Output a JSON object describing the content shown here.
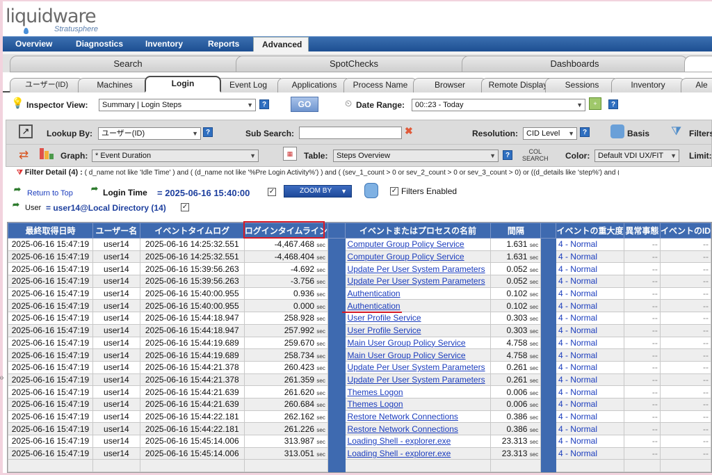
{
  "logo": {
    "name": "liquidware",
    "product": "Stratusphere"
  },
  "topnav": {
    "items": [
      "Overview",
      "Diagnostics",
      "Inventory",
      "Reports",
      "Advanced"
    ],
    "active": "Advanced"
  },
  "section_tabs": [
    "Search",
    "SpotChecks",
    "Dashboards"
  ],
  "sub_tabs": [
    "ユーザー(ID)",
    "Machines",
    "Login",
    "Event Log",
    "Applications",
    "Process Name",
    "Browser",
    "Remote Display",
    "Sessions",
    "Inventory",
    "Ale"
  ],
  "inspector": {
    "label": "Inspector View:",
    "value": "Summary | Login Steps",
    "go": "GO",
    "date_label": "Date Range:",
    "date_value": "00::23 - Today"
  },
  "toolbar": {
    "lookup_label": "Lookup By:",
    "lookup_value": "ユーザー(ID)",
    "subsearch_label": "Sub Search:",
    "resolution_label": "Resolution:",
    "resolution_value": "CID Level",
    "basis": "Basis",
    "filters": "Filters",
    "graph_label": "Graph:",
    "graph_value": "* Event Duration",
    "table_label": "Table:",
    "table_value": "Steps Overview",
    "col_search": "COL",
    "col_search2": "SEARCH",
    "color_label": "Color:",
    "color_value": "Default VDI UX/FIT",
    "limit_label": "Limit:"
  },
  "filter": {
    "label": "Filter Detail (4) :",
    "text": "( d_name not like 'Idle Time' )  and  ( (d_name not like '%Pre Login Activity%') )  and  ( (sev_1_count > 0 or sev_2_count > 0 or sev_3_count > 0) or ((d_details like 'step%') and (d_name not like"
  },
  "nav": {
    "return": "Return to Top",
    "login_time_label": "Login Time",
    "login_time_value": "= 2025-06-16 15:40:00",
    "zoom": "ZOOM BY",
    "filters_enabled": "Filters Enabled",
    "user_label": "User",
    "user_value": "= user14@Local Directory (14)"
  },
  "table": {
    "headers": [
      "最終取得日時",
      "ユーザー名",
      "イベントタイムログ",
      "ログインタイムライン",
      "",
      "イベントまたはプロセスの名前",
      "間隔",
      "",
      "イベントの重大度",
      "異常事態",
      "イベントのID"
    ],
    "unit": "sec",
    "rows": [
      [
        "2025-06-16 15:47:19",
        "user14",
        "2025-06-16 14:25:32.551",
        "-4,467.468",
        "Computer Group Policy Service",
        "1.631",
        "4 - Normal",
        "--",
        "--"
      ],
      [
        "2025-06-16 15:47:19",
        "user14",
        "2025-06-16 14:25:32.551",
        "-4,468.404",
        "Computer Group Policy Service",
        "1.631",
        "4 - Normal",
        "--",
        "--"
      ],
      [
        "2025-06-16 15:47:19",
        "user14",
        "2025-06-16 15:39:56.263",
        "-4.692",
        "Update Per User System Parameters",
        "0.052",
        "4 - Normal",
        "--",
        "--"
      ],
      [
        "2025-06-16 15:47:19",
        "user14",
        "2025-06-16 15:39:56.263",
        "-3.756",
        "Update Per User System Parameters",
        "0.052",
        "4 - Normal",
        "--",
        "--"
      ],
      [
        "2025-06-16 15:47:19",
        "user14",
        "2025-06-16 15:40:00.955",
        "0.936",
        "Authentication",
        "0.102",
        "4 - Normal",
        "--",
        "--"
      ],
      [
        "2025-06-16 15:47:19",
        "user14",
        "2025-06-16 15:40:00.955",
        "0.000",
        "Authentication",
        "0.102",
        "4 - Normal",
        "--",
        "--"
      ],
      [
        "2025-06-16 15:47:19",
        "user14",
        "2025-06-16 15:44:18.947",
        "258.928",
        "User Profile Service",
        "0.303",
        "4 - Normal",
        "--",
        "--"
      ],
      [
        "2025-06-16 15:47:19",
        "user14",
        "2025-06-16 15:44:18.947",
        "257.992",
        "User Profile Service",
        "0.303",
        "4 - Normal",
        "--",
        "--"
      ],
      [
        "2025-06-16 15:47:19",
        "user14",
        "2025-06-16 15:44:19.689",
        "259.670",
        "Main User Group Policy Service",
        "4.758",
        "4 - Normal",
        "--",
        "--"
      ],
      [
        "2025-06-16 15:47:19",
        "user14",
        "2025-06-16 15:44:19.689",
        "258.734",
        "Main User Group Policy Service",
        "4.758",
        "4 - Normal",
        "--",
        "--"
      ],
      [
        "2025-06-16 15:47:19",
        "user14",
        "2025-06-16 15:44:21.378",
        "260.423",
        "Update Per User System Parameters",
        "0.261",
        "4 - Normal",
        "--",
        "--"
      ],
      [
        "2025-06-16 15:47:19",
        "user14",
        "2025-06-16 15:44:21.378",
        "261.359",
        "Update Per User System Parameters",
        "0.261",
        "4 - Normal",
        "--",
        "--"
      ],
      [
        "2025-06-16 15:47:19",
        "user14",
        "2025-06-16 15:44:21.639",
        "261.620",
        "Themes Logon",
        "0.006",
        "4 - Normal",
        "--",
        "--"
      ],
      [
        "2025-06-16 15:47:19",
        "user14",
        "2025-06-16 15:44:21.639",
        "260.684",
        "Themes Logon",
        "0.006",
        "4 - Normal",
        "--",
        "--"
      ],
      [
        "2025-06-16 15:47:19",
        "user14",
        "2025-06-16 15:44:22.181",
        "262.162",
        "Restore Network Connections",
        "0.386",
        "4 - Normal",
        "--",
        "--"
      ],
      [
        "2025-06-16 15:47:19",
        "user14",
        "2025-06-16 15:44:22.181",
        "261.226",
        "Restore Network Connections",
        "0.386",
        "4 - Normal",
        "--",
        "--"
      ],
      [
        "2025-06-16 15:47:19",
        "user14",
        "2025-06-16 15:45:14.006",
        "313.987",
        "Loading Shell - explorer.exe",
        "23.313",
        "4 - Normal",
        "--",
        "--"
      ],
      [
        "2025-06-16 15:47:19",
        "user14",
        "2025-06-16 15:45:14.006",
        "313.051",
        "Loading Shell - explorer.exe",
        "23.313",
        "4 - Normal",
        "--",
        "--"
      ]
    ]
  },
  "colors": {
    "nav_blue": "#1d4f92",
    "header_blue": "#3e6ab0",
    "link_blue": "#1a3cbd",
    "highlight_red": "#d61a26"
  }
}
